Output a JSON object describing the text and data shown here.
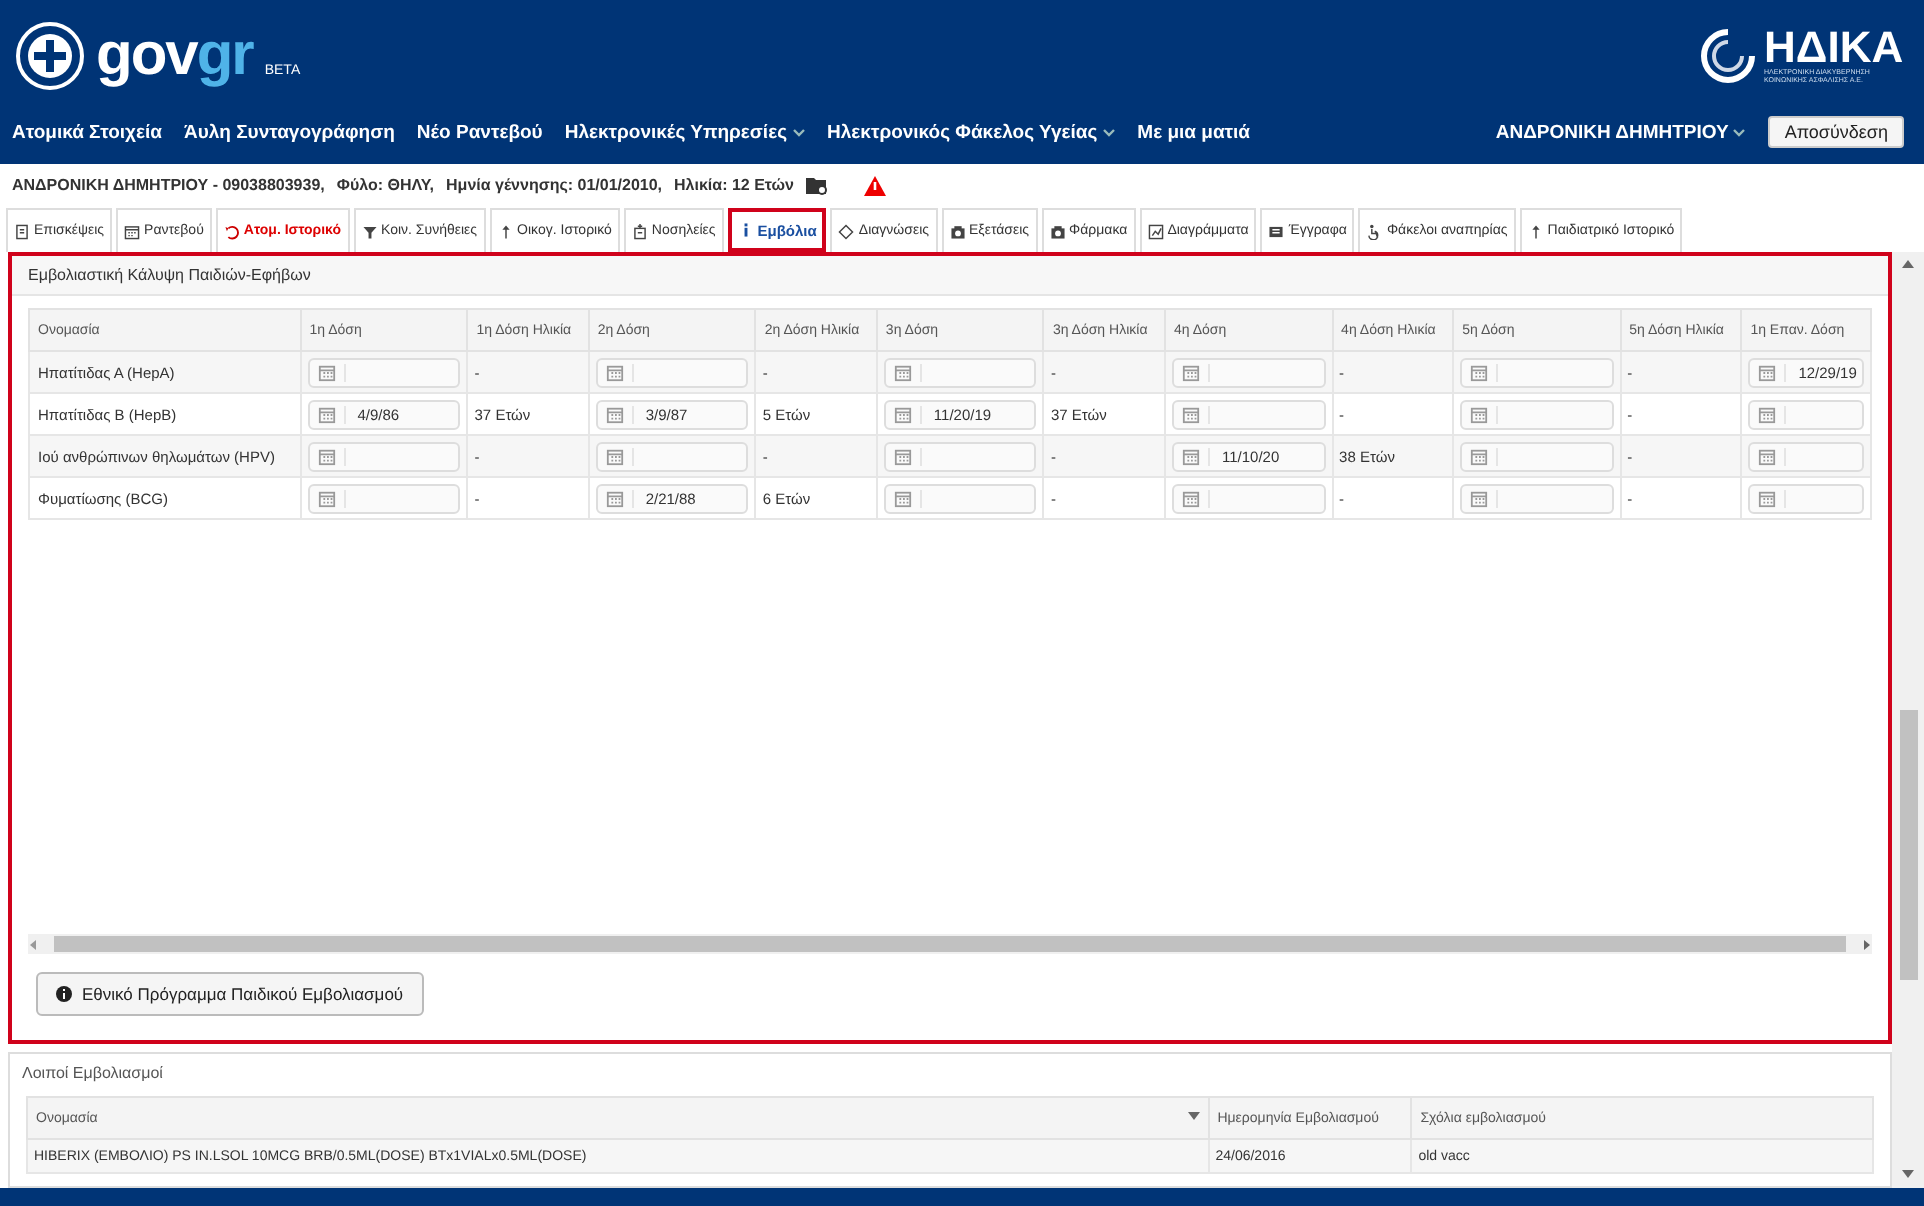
{
  "header": {
    "logo": {
      "main": "gov",
      "accent": "gr",
      "badge": "BETA"
    },
    "org_logo": {
      "name": "ΗΔΙΚΑ",
      "subtitle": "ΗΛΕΚΤΡΟΝΙΚΗ ΔΙΑΚΥΒΕΡΝΗΣΗ ΚΟΙΝΩΝΙΚΗΣ ΑΣΦΑΛΙΣΗΣ Α.Ε."
    },
    "nav": [
      {
        "label": "Ατομικά Στοιχεία",
        "has_menu": false
      },
      {
        "label": "Άυλη Συνταγογράφηση",
        "has_menu": false
      },
      {
        "label": "Νέο Ραντεβού",
        "has_menu": false
      },
      {
        "label": "Ηλεκτρονικές Υπηρεσίες",
        "has_menu": true
      },
      {
        "label": "Ηλεκτρονικός Φάκελος Υγείας",
        "has_menu": true
      },
      {
        "label": "Με μια ματιά",
        "has_menu": false
      }
    ],
    "user": "ΑΝΔΡΟΝΙΚΗ ΔΗΜΗΤΡΙΟΥ",
    "logout": "Αποσύνδεση"
  },
  "patient": [
    "ΑΝΔΡΟΝΙΚΗ ΔΗΜΗΤΡΙΟΥ - 09038803939,",
    "Φύλο: ΘΗΛΥ,",
    "Ημνία γέννησης: 01/01/2010,",
    "Ηλικία: 12 Ετών"
  ],
  "tabs": [
    {
      "label": "Επισκέψεις",
      "selected": false,
      "flagged": false
    },
    {
      "label": "Ραντεβού",
      "selected": false,
      "flagged": false
    },
    {
      "label": "Ατομ. Ιστορικό",
      "selected": false,
      "flagged": true
    },
    {
      "label": "Κοιν. Συνήθειες",
      "selected": false,
      "flagged": false
    },
    {
      "label": "Οικογ. Ιστορικό",
      "selected": false,
      "flagged": false
    },
    {
      "label": "Νοσηλείες",
      "selected": false,
      "flagged": false
    },
    {
      "label": "Εμβόλια",
      "selected": true,
      "flagged": false
    },
    {
      "label": "Διαγνώσεις",
      "selected": false,
      "flagged": false
    },
    {
      "label": "Εξετάσεις",
      "selected": false,
      "flagged": false
    },
    {
      "label": "Φάρμακα",
      "selected": false,
      "flagged": false
    },
    {
      "label": "Διαγράμματα",
      "selected": false,
      "flagged": false
    },
    {
      "label": "Έγγραφα",
      "selected": false,
      "flagged": false
    },
    {
      "label": "Φάκελοι αναπηρίας",
      "selected": false,
      "flagged": false
    },
    {
      "label": "Παιδιατρικό Ιστορικό",
      "selected": false,
      "flagged": false
    }
  ],
  "coverage": {
    "title": "Εμβολιαστική Κάλυψη Παιδιών-Εφήβων",
    "columns": [
      "Ονομασία",
      "1η Δόση",
      "1η Δόση Ηλικία",
      "2η Δόση",
      "2η Δόση Ηλικία",
      "3η Δόση",
      "3η Δόση Ηλικία",
      "4η Δόση",
      "4η Δόση Ηλικία",
      "5η Δόση",
      "5η Δόση Ηλικία",
      "1η Επαν. Δόση"
    ],
    "rows": [
      {
        "name": "Ηπατίτιδας Α (HepA)",
        "doses": [
          {
            "age": "-"
          },
          {
            "age": "-"
          },
          {
            "age": "-"
          },
          {
            "age": "-"
          },
          {
            "age": "-"
          }
        ],
        "revaccination": "12/29/19"
      },
      {
        "name": "Ηπατίτιδας Β (HepB)",
        "doses": [
          {
            "date": "4/9/86",
            "age": "37 Ετών"
          },
          {
            "date": "3/9/87",
            "age": "5 Ετών"
          },
          {
            "date": "11/20/19",
            "age": "37 Ετών"
          },
          {
            "age": "-"
          },
          {
            "age": "-"
          }
        ]
      },
      {
        "name": "Ιού ανθρώπινων θηλωμάτων (HPV)",
        "doses": [
          {
            "age": "-"
          },
          {
            "age": "-"
          },
          {
            "age": "-"
          },
          {
            "date": "11/10/20",
            "age": "38 Ετών"
          },
          {
            "age": "-"
          }
        ]
      },
      {
        "name": "Φυματίωσης (BCG)",
        "doses": [
          {
            "age": "-"
          },
          {
            "date": "2/21/88",
            "age": "6 Ετών"
          },
          {
            "age": "-"
          },
          {
            "age": "-"
          },
          {
            "age": "-"
          }
        ]
      }
    ],
    "button": "Εθνικό Πρόγραμμα Παιδικού Εμβολιασμού"
  },
  "other": {
    "title": "Λοιποί Εμβολιασμοί",
    "columns": [
      "Ονομασία",
      "Ημερομηνία Εμβολιασμού",
      "Σχόλια εμβολιασμού"
    ],
    "rows": [
      [
        "HIBERIX (ΕΜΒΟΛΙΟ) PS IN.LSOL 10MCG BRB/0.5ML(DOSE) BTx1VIALx0.5ML(DOSE)",
        "24/06/2016",
        "old vacc"
      ]
    ]
  }
}
